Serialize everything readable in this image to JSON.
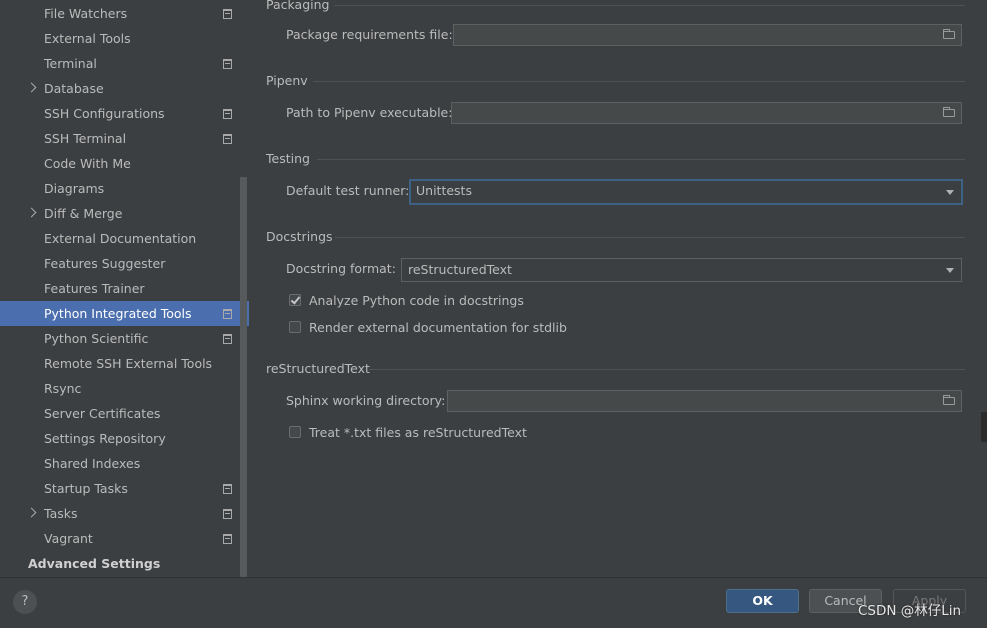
{
  "sidebar": {
    "items": [
      {
        "label": "File Watchers"
      },
      {
        "label": "External Tools"
      },
      {
        "label": "Terminal"
      },
      {
        "label": "Database"
      },
      {
        "label": "SSH Configurations"
      },
      {
        "label": "SSH Terminal"
      },
      {
        "label": "Code With Me"
      },
      {
        "label": "Diagrams"
      },
      {
        "label": "Diff & Merge"
      },
      {
        "label": "External Documentation"
      },
      {
        "label": "Features Suggester"
      },
      {
        "label": "Features Trainer"
      },
      {
        "label": "Python Integrated Tools"
      },
      {
        "label": "Python Scientific"
      },
      {
        "label": "Remote SSH External Tools"
      },
      {
        "label": "Rsync"
      },
      {
        "label": "Server Certificates"
      },
      {
        "label": "Settings Repository"
      },
      {
        "label": "Shared Indexes"
      },
      {
        "label": "Startup Tasks"
      },
      {
        "label": "Tasks"
      },
      {
        "label": "Vagrant"
      },
      {
        "label": "Advanced Settings"
      }
    ],
    "selected": "Python Integrated Tools"
  },
  "packaging": {
    "title": "Packaging",
    "requirements_label": "Package requirements file:",
    "requirements_value": ""
  },
  "pipenv": {
    "title": "Pipenv",
    "path_label": "Path to Pipenv executable:",
    "path_value": ""
  },
  "testing": {
    "title": "Testing",
    "runner_label": "Default test runner:",
    "runner_value": "Unittests"
  },
  "docstrings": {
    "title": "Docstrings",
    "format_label": "Docstring format:",
    "format_value": "reStructuredText",
    "analyze_label": "Analyze Python code in docstrings",
    "analyze_checked": true,
    "render_label": "Render external documentation for stdlib",
    "render_checked": false
  },
  "restructuredtext": {
    "title": "reStructuredText",
    "sphinx_label": "Sphinx working directory:",
    "sphinx_value": "",
    "treat_label": "Treat *.txt files as reStructuredText",
    "treat_checked": false
  },
  "footer": {
    "help": "?",
    "ok": "OK",
    "cancel": "Cancel",
    "apply": "Apply",
    "watermark": "CSDN @林仔Lin"
  }
}
